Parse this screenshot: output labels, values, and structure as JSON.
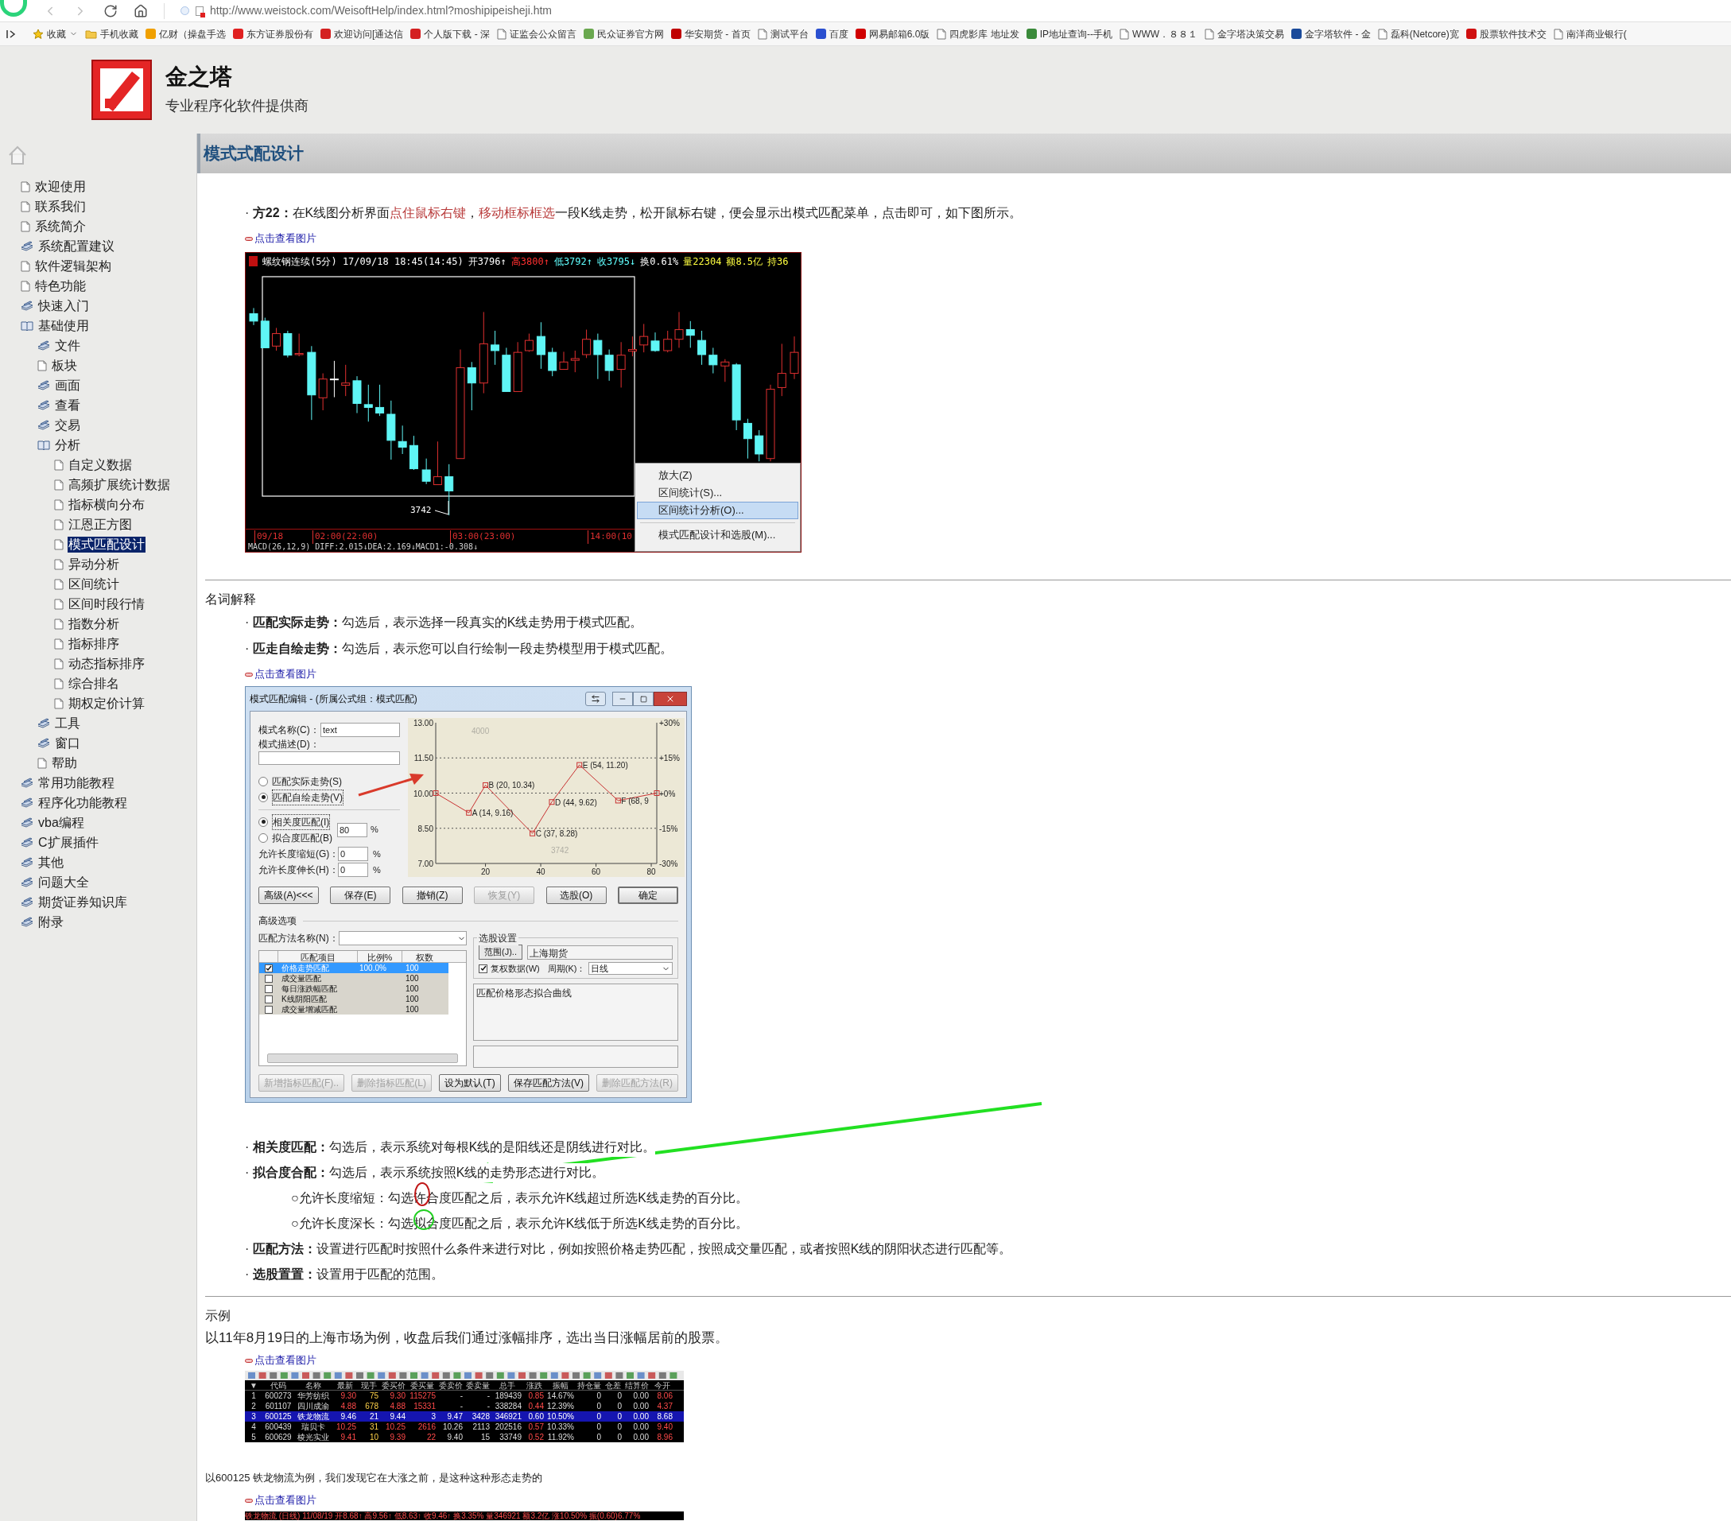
{
  "browser": {
    "url": "http://www.weistock.com/WeisoftHelp/index.html?moshipipeisheji.htm",
    "bookmarks": [
      {
        "kind": "star",
        "label": "收藏"
      },
      {
        "kind": "folder",
        "label": "手机收藏"
      },
      {
        "kind": "site",
        "label": "亿财（操盘手选",
        "color": "#f0a000"
      },
      {
        "kind": "site",
        "label": "东方证券股份有",
        "color": "#e02020"
      },
      {
        "kind": "site",
        "label": "欢迎访问[通达信",
        "color": "#d42020"
      },
      {
        "kind": "site",
        "label": "个人版下载 - 深",
        "color": "#d42021"
      },
      {
        "kind": "page",
        "label": "证监会公众留言"
      },
      {
        "kind": "site",
        "label": "民众证券官方网",
        "color": "#6aa84f"
      },
      {
        "kind": "site",
        "label": "华安期货 - 首页",
        "color": "#c00000"
      },
      {
        "kind": "page",
        "label": "测试平台"
      },
      {
        "kind": "site",
        "label": "百度",
        "color": "#2b50d0"
      },
      {
        "kind": "site",
        "label": "网易邮箱6.0版",
        "color": "#d00000"
      },
      {
        "kind": "page",
        "label": "四虎影库 地址发"
      },
      {
        "kind": "site",
        "label": "IP地址查询--手机",
        "color": "#3a8a3a"
      },
      {
        "kind": "page",
        "label": "WWW．８８１"
      },
      {
        "kind": "page",
        "label": "金字塔决策交易"
      },
      {
        "kind": "site",
        "label": "金字塔软件 - 金",
        "color": "#1a4a9a"
      },
      {
        "kind": "page",
        "label": "磊科(Netcore)宽"
      },
      {
        "kind": "site",
        "label": "股票软件技术交",
        "color": "#d01010"
      },
      {
        "kind": "page",
        "label": "南洋商业银行("
      }
    ]
  },
  "site": {
    "title": "金之塔",
    "subtitle": "专业程序化软件提供商"
  },
  "sidebar": {
    "items": [
      {
        "label": "欢迎使用",
        "kind": "page",
        "selected": false
      },
      {
        "label": "联系我们",
        "kind": "page",
        "selected": false
      },
      {
        "label": "系统简介",
        "kind": "page",
        "selected": false
      },
      {
        "label": "系统配置建议",
        "kind": "book",
        "expanded": false,
        "selected": false
      },
      {
        "label": "软件逻辑架构",
        "kind": "page",
        "selected": false
      },
      {
        "label": "特色功能",
        "kind": "page",
        "selected": false
      },
      {
        "label": "快速入门",
        "kind": "book",
        "expanded": false,
        "selected": false
      },
      {
        "label": "基础使用",
        "kind": "book",
        "expanded": true,
        "selected": false,
        "children": [
          {
            "label": "文件",
            "kind": "book",
            "expanded": false,
            "selected": false
          },
          {
            "label": "板块",
            "kind": "page",
            "selected": false
          },
          {
            "label": "画面",
            "kind": "book",
            "expanded": false,
            "selected": false
          },
          {
            "label": "查看",
            "kind": "book",
            "expanded": false,
            "selected": false
          },
          {
            "label": "交易",
            "kind": "book",
            "expanded": false,
            "selected": false
          },
          {
            "label": "分析",
            "kind": "book",
            "expanded": true,
            "selected": false,
            "children": [
              {
                "label": "自定义数据",
                "kind": "page",
                "selected": false
              },
              {
                "label": "高频扩展统计数据",
                "kind": "page",
                "selected": false
              },
              {
                "label": "指标横向分布",
                "kind": "page",
                "selected": false
              },
              {
                "label": "江恩正方图",
                "kind": "page",
                "selected": false
              },
              {
                "label": "模式匹配设计",
                "kind": "page",
                "selected": true
              },
              {
                "label": "异动分析",
                "kind": "page",
                "selected": false
              },
              {
                "label": "区间统计",
                "kind": "page",
                "selected": false
              },
              {
                "label": "区间时段行情",
                "kind": "page",
                "selected": false
              },
              {
                "label": "指数分析",
                "kind": "page",
                "selected": false
              },
              {
                "label": "指标排序",
                "kind": "page",
                "selected": false
              },
              {
                "label": "动态指标排序",
                "kind": "page",
                "selected": false
              },
              {
                "label": "综合排名",
                "kind": "page",
                "selected": false
              },
              {
                "label": "期权定价计算",
                "kind": "page",
                "selected": false
              }
            ]
          },
          {
            "label": "工具",
            "kind": "book",
            "expanded": false,
            "selected": false
          },
          {
            "label": "窗口",
            "kind": "book",
            "expanded": false,
            "selected": false
          },
          {
            "label": "帮助",
            "kind": "page",
            "selected": false
          }
        ]
      },
      {
        "label": "常用功能教程",
        "kind": "book",
        "expanded": false,
        "selected": false
      },
      {
        "label": "程序化功能教程",
        "kind": "book",
        "expanded": false,
        "selected": false
      },
      {
        "label": "vba编程",
        "kind": "book",
        "expanded": false,
        "selected": false
      },
      {
        "label": "C扩展插件",
        "kind": "book",
        "expanded": false,
        "selected": false
      },
      {
        "label": "其他",
        "kind": "book",
        "expanded": false,
        "selected": false
      },
      {
        "label": "问题大全",
        "kind": "book",
        "expanded": false,
        "selected": false
      },
      {
        "label": "期货证券知识库",
        "kind": "book",
        "expanded": false,
        "selected": false
      },
      {
        "label": "附录",
        "kind": "book",
        "expanded": false,
        "selected": false
      }
    ]
  },
  "page": {
    "title": "模式式配设计"
  },
  "intro": {
    "segments": [
      {
        "text": "· ",
        "kind": "plain"
      },
      {
        "text": "方22：",
        "kind": "bold"
      },
      {
        "text": "在K线图分析界面",
        "kind": "plain"
      },
      {
        "text": "点住鼠标右键",
        "kind": "red"
      },
      {
        "text": "，",
        "kind": "plain"
      },
      {
        "text": "移动框标框选",
        "kind": "red"
      },
      {
        "text": "一段K线走势，松开鼠标右键，便会显示出模式匹配菜单，点击即可，如下图所示。",
        "kind": "plain"
      }
    ]
  },
  "kline_figure": {
    "link": "点击查看图片",
    "header": [
      {
        "text": "螺纹钢连续(5分) 17/09/18 18:45(14:45)",
        "color": "#ffffff"
      },
      {
        "text": "开3796↑",
        "color": "#ffffff"
      },
      {
        "text": "高3800↑",
        "color": "#ff3030"
      },
      {
        "text": "低3792↑",
        "color": "#60ffff"
      },
      {
        "text": "收3795↓",
        "color": "#60ffff"
      },
      {
        "text": "换0.61%",
        "color": "#ffffff"
      },
      {
        "text": "量22304",
        "color": "#ffff40"
      },
      {
        "text": "额8.5亿",
        "color": "#ffff40"
      },
      {
        "text": "持36",
        "color": "#ffff40"
      }
    ],
    "low_label": "3742",
    "time_axis": [
      "09/18",
      "02:00(22:00)",
      "03:00(23:00)",
      "14:00(10"
    ],
    "indicator": "MACD(26,12,9) DIFF:2.015↓DEA:2.169↓MACD1:-0.308↓",
    "menu": [
      {
        "label": "放大(Z)",
        "selected": false
      },
      {
        "label": "区间统计(S)...",
        "selected": false
      },
      {
        "label": "区间统计分析(O)...",
        "selected": true
      },
      {
        "label": "模式匹配设计和选股(M)...",
        "selected": false
      }
    ]
  },
  "glossary": {
    "heading": "名词解释",
    "items": [
      "· **匹配实际走势：**勾选后，表示选择一段真实的K线走势用于模式匹配。",
      "· **匹走自绘走势：**勾选后，表示您可以自行绘制一段走势模型用于模式匹配。"
    ],
    "link": "点击查看图片"
  },
  "dialog": {
    "title": "模式匹配编辑 - (所属公式组：模式匹配)",
    "name_label": "模式名称(C)：",
    "name_value": "text",
    "desc_label": "模式描述(D)：",
    "trend_options": [
      {
        "label": "匹配实际走势(S)",
        "selected": false
      },
      {
        "label": "匹配自绘走势(V)",
        "selected": true
      }
    ],
    "match_options": [
      {
        "label": "相关度匹配(I)",
        "selected": true
      },
      {
        "label": "拟合度匹配(B)",
        "selected": false
      }
    ],
    "threshold": {
      "value": "80",
      "unit": "%"
    },
    "length_fields": [
      {
        "label": "允许长度缩短(G)：",
        "value": "0",
        "unit": "%"
      },
      {
        "label": "允许长度伸长(H)：",
        "value": "0",
        "unit": "%"
      }
    ],
    "chart_data": {
      "type": "line",
      "x": [
        2,
        14,
        20,
        37,
        44,
        54,
        68,
        82
      ],
      "xlim": [
        2,
        82
      ],
      "ylim": [
        7,
        13
      ],
      "grid": true,
      "xticks": [
        20,
        40,
        60,
        80
      ],
      "yticks": [
        {
          "value": 13,
          "label": "13.00"
        },
        {
          "value": 11.5,
          "label": "11.50"
        },
        {
          "value": 10,
          "label": "10.00"
        },
        {
          "value": 8.5,
          "label": "8.50"
        },
        {
          "value": 7,
          "label": "7.00"
        }
      ],
      "series": [
        {
          "color": "#c83232",
          "marker": "square",
          "values": [
            10,
            9.16,
            10.34,
            8.28,
            9.62,
            11.2,
            9.68,
            10
          ]
        }
      ],
      "annotations": [
        {
          "x": 14,
          "y": 9.16,
          "text": "A (14, 9.16)"
        },
        {
          "x": 20,
          "y": 10.34,
          "text": "B (20, 10.34)"
        },
        {
          "x": 37,
          "y": 8.28,
          "text": "C (37, 8.28)"
        },
        {
          "x": 44,
          "y": 9.62,
          "text": "D (44, 9.62)"
        },
        {
          "x": 54,
          "y": 11.2,
          "text": "E (54, 11.20)"
        },
        {
          "x": 68,
          "y": 9.68,
          "text": "F (68, 9"
        }
      ]
    },
    "right_axis": [
      "+30%",
      "+15%",
      "+0%",
      "-15%",
      "-30%"
    ],
    "trace_labels": [
      "4000",
      "3742"
    ],
    "buttons": [
      {
        "label": "高级(A)<<<",
        "disabled": false,
        "default": false
      },
      {
        "label": "保存(E)",
        "disabled": false,
        "default": false
      },
      {
        "label": "撤销(Z)",
        "disabled": false,
        "default": false
      },
      {
        "label": "恢复(Y)",
        "disabled": true,
        "default": false
      },
      {
        "label": "选股(O)",
        "disabled": false,
        "default": false
      },
      {
        "label": "确定",
        "disabled": false,
        "default": true
      }
    ],
    "advanced": {
      "heading": "高级选项",
      "method_label": "匹配方法名称(N)：",
      "columns": [
        "匹配项目",
        "比例%",
        "权数"
      ],
      "rows": [
        {
          "name": "价格走势匹配",
          "ratio": "100.0%",
          "weight": "100",
          "checked": true,
          "selected": true
        },
        {
          "name": "成交量匹配",
          "weight": "100",
          "checked": false,
          "selected": false
        },
        {
          "name": "每日涨跌幅匹配",
          "weight": "100",
          "checked": false,
          "selected": false
        },
        {
          "name": "K线阴阳匹配",
          "weight": "100",
          "checked": false,
          "selected": false
        },
        {
          "name": "成交量增减匹配",
          "weight": "100",
          "checked": false,
          "selected": false
        }
      ]
    },
    "stock_settings": {
      "heading": "选股设置",
      "range_button": "范围(J)..",
      "range_value": "上海期货",
      "adjusted": {
        "label": "复权数据(W)",
        "checked": true
      },
      "period_label": "周期(K)：",
      "period_value": "日线"
    },
    "description": "匹配价格形态拟合曲线",
    "footer_buttons": [
      {
        "label": "新增指标匹配(F)..",
        "disabled": true
      },
      {
        "label": "删除指标匹配(L)",
        "disabled": true
      },
      {
        "label": "设为默认(T)",
        "disabled": false
      },
      {
        "label": "保存匹配方法(V)",
        "disabled": false
      },
      {
        "label": "删除匹配方法(R)",
        "disabled": true
      }
    ]
  },
  "notes": {
    "items": [
      {
        "kind": "bullet",
        "text": "· **相关度匹配：**勾选后，表示系统对每根K线的是阳线还是阴线进行对比。"
      },
      {
        "kind": "bullet",
        "text": "· **拟合度合配：**勾选后，表示系统按照K线的走势形态进行对比。"
      },
      {
        "kind": "sub",
        "text": "○允许长度缩短：勾选许合度匹配之后，表示允许K线超过所选K线走势的百分比。"
      },
      {
        "kind": "sub",
        "text": "○允许长度深长：勾选拟合度匹配之后，表示允许K线低于所选K线走势的百分比。"
      },
      {
        "kind": "bullet",
        "text": "· **匹配方法：**设置进行匹配时按照什么条件来进行对比，例如按照价格走势匹配，按照成交量匹配，或者按照K线的阴阳状态进行匹配等。"
      },
      {
        "kind": "bullet",
        "text": "· **选股置置：**设置用于匹配的范围。"
      }
    ]
  },
  "example": {
    "heading": "示例",
    "text": "以11年8月19日的上海市场为例，收盘后我们通过涨幅排序，选出当日涨幅居前的股票。",
    "table_figure": {
      "link": "点击查看图片",
      "columns": [
        "▼",
        "代码",
        "名称",
        "最新",
        "现手",
        "委买价",
        "委买量",
        "委卖价",
        "委卖量",
        "总手",
        "涨跌",
        "振幅",
        "持仓量",
        "仓差",
        "结算价",
        "今开"
      ],
      "rows": [
        {
          "cells": [
            "1",
            "600273",
            "华芳纺织",
            "9.30",
            "75",
            "9.30",
            "115275",
            "-",
            "-",
            "189439",
            "0.85",
            "14.67%",
            "0",
            "0",
            "0.00",
            "8.06"
          ],
          "selected": false
        },
        {
          "cells": [
            "2",
            "601107",
            "四川成渝",
            "4.88",
            "678",
            "4.88",
            "15331",
            "-",
            "-",
            "338284",
            "0.44",
            "12.39%",
            "0",
            "0",
            "0.00",
            "4.37"
          ],
          "selected": false
        },
        {
          "cells": [
            "3",
            "600125",
            "铁龙物流",
            "9.46",
            "21",
            "9.44",
            "3",
            "9.47",
            "3428",
            "346921",
            "0.60",
            "10.50%",
            "0",
            "0",
            "0.00",
            "8.68"
          ],
          "selected": true
        },
        {
          "cells": [
            "4",
            "600439",
            "瑞贝卡",
            "10.25",
            "31",
            "10.25",
            "2616",
            "10.26",
            "2113",
            "202516",
            "0.57",
            "10.33%",
            "0",
            "0",
            "0.00",
            "9.40"
          ],
          "selected": false
        },
        {
          "cells": [
            "5",
            "600629",
            "棱光实业",
            "9.41",
            "10",
            "9.39",
            "22",
            "9.40",
            "15",
            "33749",
            "0.52",
            "11.92%",
            "0",
            "0",
            "0.00",
            "8.96"
          ],
          "selected": false
        }
      ]
    },
    "text_2": "以600125 铁龙物流为例，我们发现它在大涨之前，是这种这种形态走势的",
    "strip_figure": {
      "link": "点击查看图片",
      "text": "铁龙物流 (日线) 11/08/19 开8.68↑ 高9.56↑ 低8.63↑ 收9.46↑ 换3.35% 量346921 额3.2亿 涨10.50% 振(0.60)6.77%"
    }
  }
}
